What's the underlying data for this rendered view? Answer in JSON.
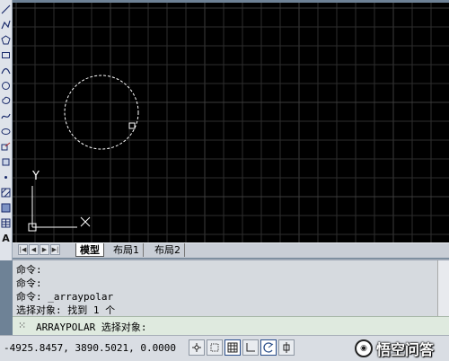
{
  "left_toolbar": {
    "tools": [
      {
        "icon": "line-icon"
      },
      {
        "icon": "pline-icon"
      },
      {
        "icon": "polygon-icon"
      },
      {
        "icon": "rectangle-icon"
      },
      {
        "icon": "arc-icon"
      },
      {
        "icon": "circle-icon"
      },
      {
        "icon": "revcloud-icon"
      },
      {
        "icon": "spline-icon"
      },
      {
        "icon": "ellipse-icon"
      },
      {
        "icon": "insert-block-icon"
      },
      {
        "icon": "make-block-icon"
      },
      {
        "icon": "point-icon"
      },
      {
        "icon": "hatch-icon"
      },
      {
        "icon": "gradient-icon"
      },
      {
        "icon": "region-icon"
      },
      {
        "icon": "table-icon"
      },
      {
        "icon": "mtext-icon",
        "letter": "A"
      }
    ]
  },
  "drawing": {
    "ucs_icon": {
      "y_label": "Y",
      "x_label": "X"
    },
    "colors": {
      "background": "#000000",
      "grid": "#2e2e2e",
      "grid_major": "#3d3d3d",
      "selection": "#ffffff"
    }
  },
  "layout_tabs": {
    "nav_buttons": [
      "first",
      "previous",
      "next",
      "last"
    ],
    "tabs": [
      {
        "label": "模型",
        "active": true
      },
      {
        "label": "布局1",
        "active": false
      },
      {
        "label": "布局2",
        "active": false
      }
    ]
  },
  "command_history": {
    "lines": [
      "命令:",
      "命令:",
      "命令: _arraypolar",
      "选择对象: 找到 1 个"
    ]
  },
  "command_prompt": {
    "icon": "command-line-icon",
    "text": "ARRAYPOLAR 选择对象:"
  },
  "status_bar": {
    "coordinates": "-4925.8457, 3890.5021, 0.0000",
    "buttons": [
      {
        "name": "infer-constraints-button",
        "icon": "infer-icon"
      },
      {
        "name": "snap-mode-button",
        "icon": "snap-icon"
      },
      {
        "name": "grid-display-button",
        "icon": "grid-icon",
        "on": true
      },
      {
        "name": "ortho-mode-button",
        "icon": "ortho-icon"
      },
      {
        "name": "polar-tracking-button",
        "icon": "polar-icon",
        "on": true
      },
      {
        "name": "object-snap-button",
        "icon": "osnap-icon"
      }
    ]
  },
  "watermark": {
    "text": "悟空问答",
    "logo_icon": "wukong-logo-icon"
  }
}
